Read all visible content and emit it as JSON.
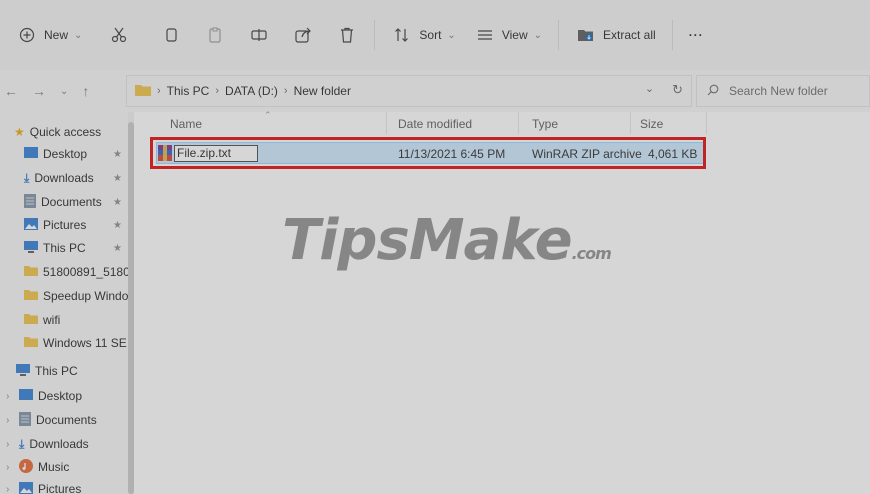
{
  "toolbar": {
    "new_label": "New",
    "sort_label": "Sort",
    "view_label": "View",
    "extract_label": "Extract all",
    "more_label": "···"
  },
  "address": {
    "crumbs": [
      "This PC",
      "DATA (D:)",
      "New folder"
    ],
    "search_placeholder": "Search New folder"
  },
  "sidebar": {
    "quick_access": "Quick access",
    "quick_items": [
      "Desktop",
      "Downloads",
      "Documents",
      "Pictures",
      "This PC",
      "51800891_51800",
      "Speedup Windo",
      "wifi",
      "Windows 11 SE"
    ],
    "this_pc": "This PC",
    "pc_items": [
      "Desktop",
      "Documents",
      "Downloads",
      "Music",
      "Pictures"
    ]
  },
  "columns": {
    "name": "Name",
    "date": "Date modified",
    "type": "Type",
    "size": "Size"
  },
  "file": {
    "name": "File.zip.txt",
    "date": "11/13/2021 6:45 PM",
    "type": "WinRAR ZIP archive",
    "size": "4,061 KB"
  },
  "watermark": {
    "text": "TipsMake",
    "suffix": ".com"
  },
  "colors": {
    "highlight": "#e00000",
    "selection": "#cce8ff",
    "folder": "#f0c040",
    "accent": "#0067c0"
  }
}
